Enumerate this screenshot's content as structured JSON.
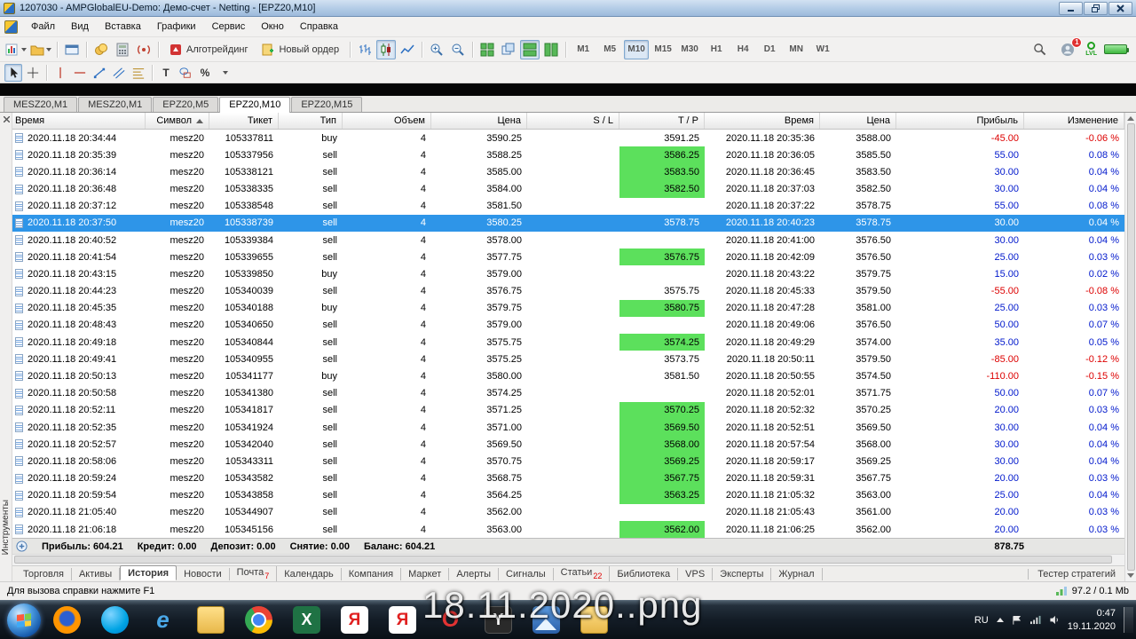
{
  "window": {
    "title": "1207030 - AMPGlobalEU-Demo: Демо-счет - Netting - [EPZ20,M10]"
  },
  "menu": {
    "items": [
      "Файл",
      "Вид",
      "Вставка",
      "Графики",
      "Сервис",
      "Окно",
      "Справка"
    ]
  },
  "toolbar": {
    "algo_label": "Алготрейдинг",
    "new_order_label": "Новый ордер",
    "timeframes": [
      "M1",
      "M5",
      "M10",
      "M15",
      "M30",
      "H1",
      "H4",
      "D1",
      "MN",
      "W1"
    ],
    "active_timeframe": "M10",
    "notification_badge": "1",
    "lvl_label": "LVL"
  },
  "drawing_tools": {
    "text_tool": "T",
    "percent_tool": "%"
  },
  "chart_tabs": {
    "tabs": [
      {
        "label": "MESZ20,M1",
        "active": false
      },
      {
        "label": "MESZ20,M1",
        "active": false
      },
      {
        "label": "EPZ20,M5",
        "active": false
      },
      {
        "label": "EPZ20,M10",
        "active": true
      },
      {
        "label": "EPZ20,M15",
        "active": false
      }
    ]
  },
  "toolbox": {
    "side_label": "Инструменты",
    "table": {
      "sort_column": "Символ",
      "headers": [
        "Время",
        "Символ",
        "Тикет",
        "Тип",
        "Объем",
        "Цена",
        "S / L",
        "T / P",
        "Время",
        "Цена",
        "Прибыль",
        "Изменение"
      ],
      "rows": [
        {
          "t1": "2020.11.18 20:34:44",
          "sym": "mesz20",
          "ticket": "105337811",
          "type": "buy",
          "vol": "4",
          "p1": "3590.25",
          "sl": "",
          "tp": "3591.25",
          "tpg": false,
          "t2": "2020.11.18 20:35:36",
          "p2": "3588.00",
          "profit": "-45.00",
          "chg": "-0.06 %",
          "neg": true,
          "sel": false
        },
        {
          "t1": "2020.11.18 20:35:39",
          "sym": "mesz20",
          "ticket": "105337956",
          "type": "sell",
          "vol": "4",
          "p1": "3588.25",
          "sl": "",
          "tp": "3586.25",
          "tpg": true,
          "t2": "2020.11.18 20:36:05",
          "p2": "3585.50",
          "profit": "55.00",
          "chg": "0.08 %",
          "neg": false,
          "sel": false
        },
        {
          "t1": "2020.11.18 20:36:14",
          "sym": "mesz20",
          "ticket": "105338121",
          "type": "sell",
          "vol": "4",
          "p1": "3585.00",
          "sl": "",
          "tp": "3583.50",
          "tpg": true,
          "t2": "2020.11.18 20:36:45",
          "p2": "3583.50",
          "profit": "30.00",
          "chg": "0.04 %",
          "neg": false,
          "sel": false
        },
        {
          "t1": "2020.11.18 20:36:48",
          "sym": "mesz20",
          "ticket": "105338335",
          "type": "sell",
          "vol": "4",
          "p1": "3584.00",
          "sl": "",
          "tp": "3582.50",
          "tpg": true,
          "t2": "2020.11.18 20:37:03",
          "p2": "3582.50",
          "profit": "30.00",
          "chg": "0.04 %",
          "neg": false,
          "sel": false
        },
        {
          "t1": "2020.11.18 20:37:12",
          "sym": "mesz20",
          "ticket": "105338548",
          "type": "sell",
          "vol": "4",
          "p1": "3581.50",
          "sl": "",
          "tp": "",
          "tpg": false,
          "t2": "2020.11.18 20:37:22",
          "p2": "3578.75",
          "profit": "55.00",
          "chg": "0.08 %",
          "neg": false,
          "sel": false
        },
        {
          "t1": "2020.11.18 20:37:50",
          "sym": "mesz20",
          "ticket": "105338739",
          "type": "sell",
          "vol": "4",
          "p1": "3580.25",
          "sl": "",
          "tp": "3578.75",
          "tpg": false,
          "t2": "2020.11.18 20:40:23",
          "p2": "3578.75",
          "profit": "30.00",
          "chg": "0.04 %",
          "neg": false,
          "sel": true
        },
        {
          "t1": "2020.11.18 20:40:52",
          "sym": "mesz20",
          "ticket": "105339384",
          "type": "sell",
          "vol": "4",
          "p1": "3578.00",
          "sl": "",
          "tp": "",
          "tpg": false,
          "t2": "2020.11.18 20:41:00",
          "p2": "3576.50",
          "profit": "30.00",
          "chg": "0.04 %",
          "neg": false,
          "sel": false
        },
        {
          "t1": "2020.11.18 20:41:54",
          "sym": "mesz20",
          "ticket": "105339655",
          "type": "sell",
          "vol": "4",
          "p1": "3577.75",
          "sl": "",
          "tp": "3576.75",
          "tpg": true,
          "t2": "2020.11.18 20:42:09",
          "p2": "3576.50",
          "profit": "25.00",
          "chg": "0.03 %",
          "neg": false,
          "sel": false
        },
        {
          "t1": "2020.11.18 20:43:15",
          "sym": "mesz20",
          "ticket": "105339850",
          "type": "buy",
          "vol": "4",
          "p1": "3579.00",
          "sl": "",
          "tp": "",
          "tpg": false,
          "t2": "2020.11.18 20:43:22",
          "p2": "3579.75",
          "profit": "15.00",
          "chg": "0.02 %",
          "neg": false,
          "sel": false
        },
        {
          "t1": "2020.11.18 20:44:23",
          "sym": "mesz20",
          "ticket": "105340039",
          "type": "sell",
          "vol": "4",
          "p1": "3576.75",
          "sl": "",
          "tp": "3575.75",
          "tpg": false,
          "t2": "2020.11.18 20:45:33",
          "p2": "3579.50",
          "profit": "-55.00",
          "chg": "-0.08 %",
          "neg": true,
          "sel": false
        },
        {
          "t1": "2020.11.18 20:45:35",
          "sym": "mesz20",
          "ticket": "105340188",
          "type": "buy",
          "vol": "4",
          "p1": "3579.75",
          "sl": "",
          "tp": "3580.75",
          "tpg": true,
          "t2": "2020.11.18 20:47:28",
          "p2": "3581.00",
          "profit": "25.00",
          "chg": "0.03 %",
          "neg": false,
          "sel": false
        },
        {
          "t1": "2020.11.18 20:48:43",
          "sym": "mesz20",
          "ticket": "105340650",
          "type": "sell",
          "vol": "4",
          "p1": "3579.00",
          "sl": "",
          "tp": "",
          "tpg": false,
          "t2": "2020.11.18 20:49:06",
          "p2": "3576.50",
          "profit": "50.00",
          "chg": "0.07 %",
          "neg": false,
          "sel": false
        },
        {
          "t1": "2020.11.18 20:49:18",
          "sym": "mesz20",
          "ticket": "105340844",
          "type": "sell",
          "vol": "4",
          "p1": "3575.75",
          "sl": "",
          "tp": "3574.25",
          "tpg": true,
          "t2": "2020.11.18 20:49:29",
          "p2": "3574.00",
          "profit": "35.00",
          "chg": "0.05 %",
          "neg": false,
          "sel": false
        },
        {
          "t1": "2020.11.18 20:49:41",
          "sym": "mesz20",
          "ticket": "105340955",
          "type": "sell",
          "vol": "4",
          "p1": "3575.25",
          "sl": "",
          "tp": "3573.75",
          "tpg": false,
          "t2": "2020.11.18 20:50:11",
          "p2": "3579.50",
          "profit": "-85.00",
          "chg": "-0.12 %",
          "neg": true,
          "sel": false
        },
        {
          "t1": "2020.11.18 20:50:13",
          "sym": "mesz20",
          "ticket": "105341177",
          "type": "buy",
          "vol": "4",
          "p1": "3580.00",
          "sl": "",
          "tp": "3581.50",
          "tpg": false,
          "t2": "2020.11.18 20:50:55",
          "p2": "3574.50",
          "profit": "-110.00",
          "chg": "-0.15 %",
          "neg": true,
          "sel": false
        },
        {
          "t1": "2020.11.18 20:50:58",
          "sym": "mesz20",
          "ticket": "105341380",
          "type": "sell",
          "vol": "4",
          "p1": "3574.25",
          "sl": "",
          "tp": "",
          "tpg": false,
          "t2": "2020.11.18 20:52:01",
          "p2": "3571.75",
          "profit": "50.00",
          "chg": "0.07 %",
          "neg": false,
          "sel": false
        },
        {
          "t1": "2020.11.18 20:52:11",
          "sym": "mesz20",
          "ticket": "105341817",
          "type": "sell",
          "vol": "4",
          "p1": "3571.25",
          "sl": "",
          "tp": "3570.25",
          "tpg": true,
          "t2": "2020.11.18 20:52:32",
          "p2": "3570.25",
          "profit": "20.00",
          "chg": "0.03 %",
          "neg": false,
          "sel": false
        },
        {
          "t1": "2020.11.18 20:52:35",
          "sym": "mesz20",
          "ticket": "105341924",
          "type": "sell",
          "vol": "4",
          "p1": "3571.00",
          "sl": "",
          "tp": "3569.50",
          "tpg": true,
          "t2": "2020.11.18 20:52:51",
          "p2": "3569.50",
          "profit": "30.00",
          "chg": "0.04 %",
          "neg": false,
          "sel": false
        },
        {
          "t1": "2020.11.18 20:52:57",
          "sym": "mesz20",
          "ticket": "105342040",
          "type": "sell",
          "vol": "4",
          "p1": "3569.50",
          "sl": "",
          "tp": "3568.00",
          "tpg": true,
          "t2": "2020.11.18 20:57:54",
          "p2": "3568.00",
          "profit": "30.00",
          "chg": "0.04 %",
          "neg": false,
          "sel": false
        },
        {
          "t1": "2020.11.18 20:58:06",
          "sym": "mesz20",
          "ticket": "105343311",
          "type": "sell",
          "vol": "4",
          "p1": "3570.75",
          "sl": "",
          "tp": "3569.25",
          "tpg": true,
          "t2": "2020.11.18 20:59:17",
          "p2": "3569.25",
          "profit": "30.00",
          "chg": "0.04 %",
          "neg": false,
          "sel": false
        },
        {
          "t1": "2020.11.18 20:59:24",
          "sym": "mesz20",
          "ticket": "105343582",
          "type": "sell",
          "vol": "4",
          "p1": "3568.75",
          "sl": "",
          "tp": "3567.75",
          "tpg": true,
          "t2": "2020.11.18 20:59:31",
          "p2": "3567.75",
          "profit": "20.00",
          "chg": "0.03 %",
          "neg": false,
          "sel": false
        },
        {
          "t1": "2020.11.18 20:59:54",
          "sym": "mesz20",
          "ticket": "105343858",
          "type": "sell",
          "vol": "4",
          "p1": "3564.25",
          "sl": "",
          "tp": "3563.25",
          "tpg": true,
          "t2": "2020.11.18 21:05:32",
          "p2": "3563.00",
          "profit": "25.00",
          "chg": "0.04 %",
          "neg": false,
          "sel": false
        },
        {
          "t1": "2020.11.18 21:05:40",
          "sym": "mesz20",
          "ticket": "105344907",
          "type": "sell",
          "vol": "4",
          "p1": "3562.00",
          "sl": "",
          "tp": "",
          "tpg": false,
          "t2": "2020.11.18 21:05:43",
          "p2": "3561.00",
          "profit": "20.00",
          "chg": "0.03 %",
          "neg": false,
          "sel": false
        },
        {
          "t1": "2020.11.18 21:06:18",
          "sym": "mesz20",
          "ticket": "105345156",
          "type": "sell",
          "vol": "4",
          "p1": "3563.00",
          "sl": "",
          "tp": "3562.00",
          "tpg": true,
          "t2": "2020.11.18 21:06:25",
          "p2": "3562.00",
          "profit": "20.00",
          "chg": "0.03 %",
          "neg": false,
          "sel": false
        }
      ]
    },
    "summary": {
      "items": [
        "Прибыль: 604.21",
        "Кредит: 0.00",
        "Депозит: 0.00",
        "Снятие: 0.00",
        "Баланс: 604.21"
      ],
      "right_value": "878.75"
    },
    "tabs": [
      {
        "label": "Торговля"
      },
      {
        "label": "Активы"
      },
      {
        "label": "История",
        "active": true
      },
      {
        "label": "Новости"
      },
      {
        "label": "Почта",
        "badge": "7"
      },
      {
        "label": "Календарь"
      },
      {
        "label": "Компания"
      },
      {
        "label": "Маркет"
      },
      {
        "label": "Алерты"
      },
      {
        "label": "Сигналы"
      },
      {
        "label": "Статьи",
        "badge": "22"
      },
      {
        "label": "Библиотека"
      },
      {
        "label": "VPS"
      },
      {
        "label": "Эксперты"
      },
      {
        "label": "Журнал"
      }
    ],
    "tester_label": "Тестер стратегий"
  },
  "status": {
    "left": "Для вызова справки нажмите F1",
    "right": "97.2 / 0.1 Mb"
  },
  "watermark": {
    "text": "18.11.2020..png"
  },
  "taskbar": {
    "apps": [
      {
        "id": "firefox",
        "letter": ""
      },
      {
        "id": "skype",
        "letter": ""
      },
      {
        "id": "ie",
        "letter": "e"
      },
      {
        "id": "folder",
        "letter": ""
      },
      {
        "id": "chrome",
        "letter": ""
      },
      {
        "id": "excel",
        "letter": "X"
      },
      {
        "id": "yandex-browser",
        "letter": "Я"
      },
      {
        "id": "yandex-browser-2",
        "letter": "Я"
      },
      {
        "id": "opera",
        "letter": "O"
      },
      {
        "id": "y-browser",
        "letter": "Y"
      },
      {
        "id": "gallery",
        "letter": ""
      },
      {
        "id": "folder-2",
        "letter": ""
      }
    ],
    "tray": {
      "lang": "RU",
      "time": "0:47",
      "date": "19.11.2020"
    }
  },
  "colors": {
    "selection": "#2e95e8",
    "tp_highlight": "#5ce05c",
    "profit_positive": "#0018cc",
    "profit_negative": "#dd0000"
  }
}
